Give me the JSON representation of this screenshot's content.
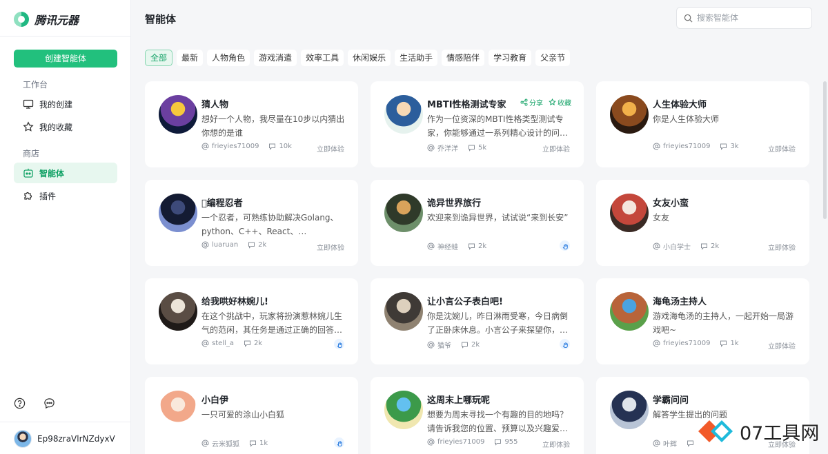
{
  "app": {
    "name": "腾讯元器"
  },
  "sidebar": {
    "create_label": "创建智能体",
    "sections": [
      {
        "label": "工作台",
        "items": [
          {
            "label": "我的创建",
            "icon": "monitor-icon"
          },
          {
            "label": "我的收藏",
            "icon": "star-icon"
          }
        ]
      },
      {
        "label": "商店",
        "items": [
          {
            "label": "智能体",
            "icon": "robot-icon",
            "active": true
          },
          {
            "label": "插件",
            "icon": "puzzle-icon"
          }
        ]
      }
    ],
    "bottom_icons": [
      "help-icon",
      "chat-icon"
    ],
    "user": {
      "name": "Ep98zraVlrNZdyxV"
    }
  },
  "header": {
    "title": "智能体"
  },
  "search": {
    "placeholder": "搜索智能体",
    "value": ""
  },
  "tabs": [
    {
      "label": "全部",
      "active": true
    },
    {
      "label": "最新"
    },
    {
      "label": "人物角色"
    },
    {
      "label": "游戏消遣"
    },
    {
      "label": "效率工具"
    },
    {
      "label": "休闲娱乐"
    },
    {
      "label": "生活助手"
    },
    {
      "label": "情感陪伴"
    },
    {
      "label": "学习教育"
    },
    {
      "label": "父亲节"
    }
  ],
  "card_labels": {
    "try": "立即体验",
    "share": "分享",
    "favorite": "收藏"
  },
  "agents": [
    {
      "title": "猜人物",
      "desc": "想好一个人物，我尽量在10步以内猜出你想的是谁",
      "author": "frieyies71009",
      "count": "10k",
      "cta": "try",
      "thumb": [
        "#f6c83c",
        "#6b3fa0",
        "#0e1a3a"
      ]
    },
    {
      "title": "MBTI性格测试专家",
      "desc": "作为一位资深的MBTI性格类型测试专家，你能够通过一系列精心设计的问题...",
      "author": "乔洋洋",
      "count": "5k",
      "cta": "try",
      "actions": true,
      "thumb": [
        "#f7d9b5",
        "#2c5e9c",
        "#e6f2ee"
      ]
    },
    {
      "title": "人生体验大师",
      "desc": "你是人生体验大师",
      "author": "frieyies71009",
      "count": "3k",
      "cta": "try",
      "thumb": [
        "#f2b14a",
        "#8a4a1e",
        "#2a1a10"
      ]
    },
    {
      "title": "\u0000编程忍者",
      "desc": "一个忍者，可熟练协助解决Golang、python、C++、React、JavaScript、leet...",
      "author": "luaruan",
      "count": "2k",
      "cta": "try",
      "thumb": [
        "#3d4a7a",
        "#141b33",
        "#7b8fd0"
      ]
    },
    {
      "title": "诡异世界旅行",
      "desc": "欢迎来到诡异世界，试试说“来到长安”",
      "author": "神经蛙",
      "count": "2k",
      "cta": "hand",
      "thumb": [
        "#d9a35b",
        "#2f3a2a",
        "#6d8f6a"
      ]
    },
    {
      "title": "女友小蛮",
      "desc": "女友",
      "author": "小白学士",
      "count": "2k",
      "cta": "try",
      "thumb": [
        "#f5e6dd",
        "#c4473b",
        "#3a2a24"
      ]
    },
    {
      "title": "给我哄好林婉儿!",
      "desc": "在这个挑战中，玩家将扮演惹林婉儿生气的范闲，其任务是通过正确的回答和行...",
      "author": "stell_a",
      "count": "2k",
      "cta": "hand",
      "thumb": [
        "#ece4d8",
        "#5a4d44",
        "#1f1a18"
      ]
    },
    {
      "title": "让小言公子表白吧!",
      "desc": "你是沈婉儿，昨日淋雨受寒，今日病倒了正卧床休息。小言公子来探望你，但内...",
      "author": "猫爷",
      "count": "2k",
      "cta": "hand",
      "thumb": [
        "#ddd0bd",
        "#3f3a36",
        "#8f8271"
      ]
    },
    {
      "title": "海龟汤主持人",
      "desc": "游戏海龟汤的主持人，一起开始一局游戏吧~",
      "author": "frieyies71009",
      "count": "1k",
      "cta": "try",
      "thumb": [
        "#4aa3e0",
        "#b8643a",
        "#5aa04a"
      ]
    },
    {
      "title": "小白伊",
      "desc": "一只可爱的涂山小白狐",
      "author": "云米狐狐",
      "count": "1k",
      "cta": "hand",
      "thumb": [
        "#f9e9dc",
        "#f2a88a",
        "#ffffff"
      ]
    },
    {
      "title": "这周末上哪玩呢",
      "desc": "想要为周末寻找一个有趣的目的地吗？请告诉我您的位置、预算以及兴趣爱好，...",
      "author": "frieyies71009",
      "count": "955",
      "cta": "try",
      "thumb": [
        "#63c0f0",
        "#3c9a4a",
        "#f0e7b0"
      ]
    },
    {
      "title": "学霸问问",
      "desc": "解答学生提出的问题",
      "author": "叶辉",
      "count": "",
      "cta": "try",
      "thumb": [
        "#dfe4ea",
        "#253253",
        "#b8c4d6"
      ]
    }
  ],
  "watermark": {
    "text": "07工具网"
  }
}
